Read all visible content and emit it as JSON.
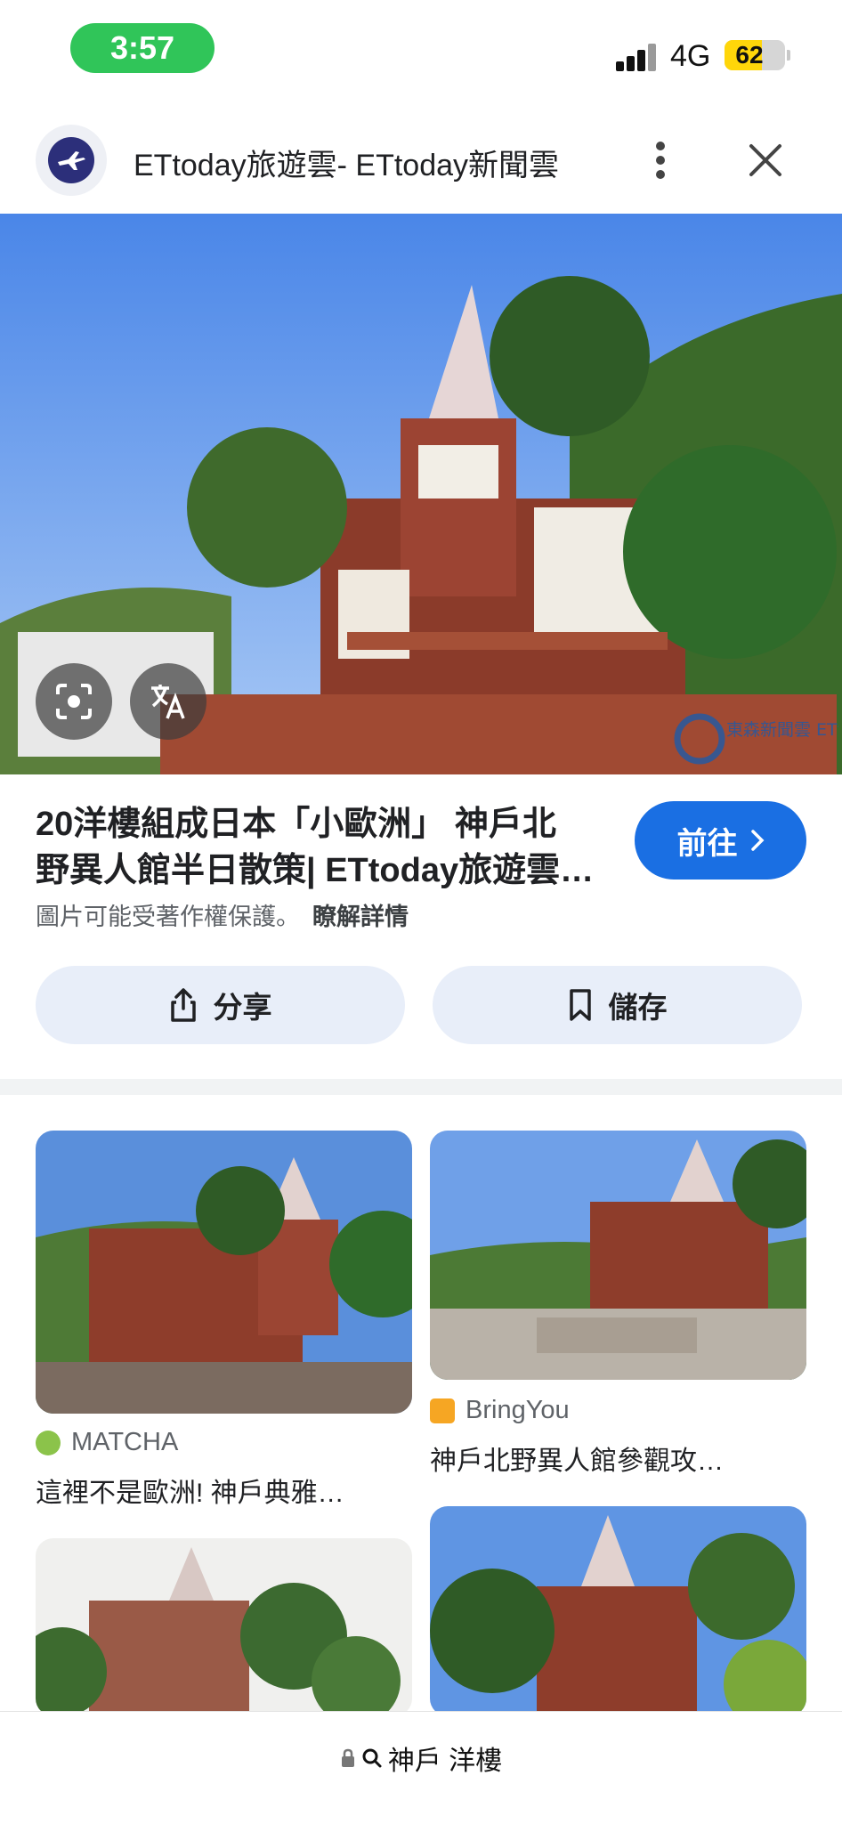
{
  "status_bar": {
    "time": "3:57",
    "network": "4G",
    "battery": "62",
    "battery_level": 0.62
  },
  "header": {
    "site_name": "ETtoday旅遊雲- ETtoday新聞雲",
    "logo_icon": "plane-icon",
    "more_icon": "more-vert-icon",
    "close_icon": "close-icon"
  },
  "hero": {
    "watermark_text": "東森新聞雲 ETtoday.net"
  },
  "result": {
    "title_line1": "20洋樓組成日本「小歐洲」 神戶北",
    "title_line2": "野異人館半日散策| ETtoday旅遊雲…",
    "visit_label": "前往",
    "copyright_text": "圖片可能受著作權保護。",
    "learn_more": "瞭解詳情",
    "share_label": "分享",
    "save_label": "儲存"
  },
  "related": [
    {
      "source": "MATCHA",
      "title": "這裡不是歐洲! 神戶典雅…"
    },
    {
      "source": "BringYou",
      "title": "神戶北野異人館參觀攻…"
    }
  ],
  "address_bar": {
    "query": "神戶 洋樓"
  },
  "colors": {
    "accent": "#1a6fe3",
    "time_pill": "#30c559",
    "action_bg": "#e8eef9"
  }
}
